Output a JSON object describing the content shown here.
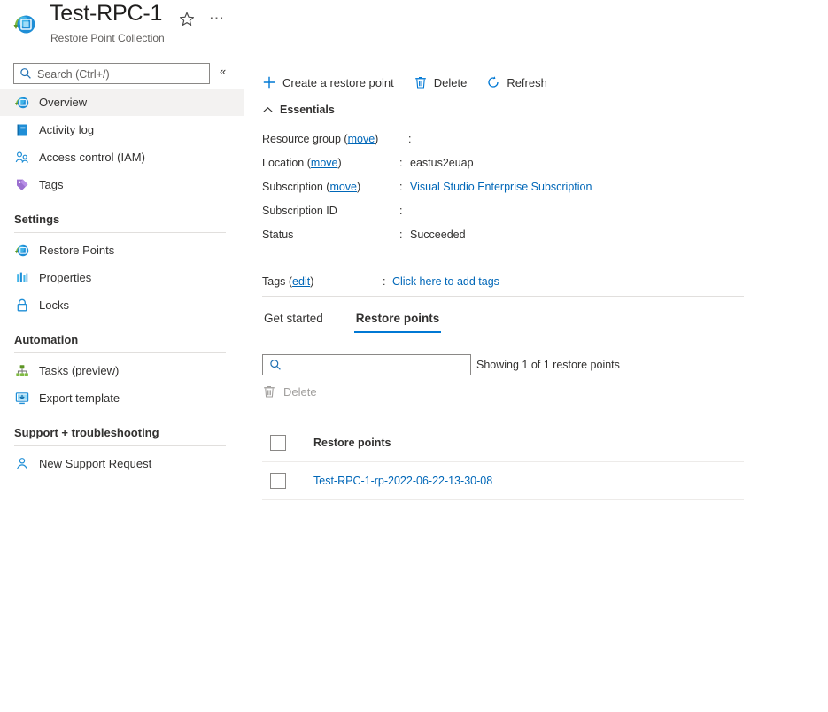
{
  "header": {
    "title": "Test-RPC-1",
    "subtitle": "Restore Point Collection",
    "favorite_icon": "star-icon",
    "more_icon": "ellipsis-icon",
    "resource_icon": "restore-point-collection-icon"
  },
  "sidebar": {
    "search": {
      "value": "",
      "placeholder": "Search (Ctrl+/)",
      "icon": "search-icon"
    },
    "collapse": {
      "label": "«",
      "icon": "chevron-double-left-icon"
    },
    "items": [
      {
        "label": "Overview",
        "icon": "overview-icon",
        "selected": true
      },
      {
        "label": "Activity log",
        "icon": "activity-log-icon",
        "selected": false
      },
      {
        "label": "Access control (IAM)",
        "icon": "access-control-icon",
        "selected": false
      },
      {
        "label": "Tags",
        "icon": "tags-icon",
        "selected": false
      }
    ],
    "sections": [
      {
        "heading": "Settings",
        "items": [
          {
            "label": "Restore Points",
            "icon": "restore-points-icon"
          },
          {
            "label": "Properties",
            "icon": "properties-icon"
          },
          {
            "label": "Locks",
            "icon": "lock-icon"
          }
        ]
      },
      {
        "heading": "Automation",
        "items": [
          {
            "label": "Tasks (preview)",
            "icon": "tasks-icon"
          },
          {
            "label": "Export template",
            "icon": "export-template-icon"
          }
        ]
      },
      {
        "heading": "Support + troubleshooting",
        "items": [
          {
            "label": "New Support Request",
            "icon": "support-request-icon"
          }
        ]
      }
    ]
  },
  "toolbar": {
    "create": {
      "label": "Create a restore point",
      "icon": "plus-icon"
    },
    "delete": {
      "label": "Delete",
      "icon": "trash-icon"
    },
    "refresh": {
      "label": "Refresh",
      "icon": "refresh-icon"
    }
  },
  "essentials": {
    "heading": "Essentials",
    "collapse_icon": "chevron-up-icon",
    "rows": [
      {
        "label": "Resource group",
        "link": "move",
        "colon": ":",
        "value": "",
        "value_is_link": false,
        "wide": true
      },
      {
        "label": "Location",
        "link": "move",
        "colon": ":",
        "value": "eastus2euap",
        "value_is_link": false,
        "wide": false
      },
      {
        "label": "Subscription",
        "link": "move",
        "colon": ":",
        "value": "Visual Studio Enterprise Subscription",
        "value_is_link": true,
        "wide": false
      },
      {
        "label": "Subscription ID",
        "link": "",
        "colon": ":",
        "value": "",
        "value_is_link": false,
        "wide": false
      },
      {
        "label": "Status",
        "link": "",
        "colon": ":",
        "value": "Succeeded",
        "value_is_link": false,
        "wide": false
      }
    ],
    "tags": {
      "label": "Tags",
      "link": "edit",
      "colon": ":",
      "value": "Click here to add tags"
    }
  },
  "tabs": [
    {
      "label": "Get started",
      "active": false
    },
    {
      "label": "Restore points",
      "active": true
    }
  ],
  "restore_points_panel": {
    "filter": {
      "value": "",
      "placeholder": "",
      "icon": "search-icon"
    },
    "showing_text": "Showing 1 of 1 restore points",
    "grid_delete": {
      "label": "Delete",
      "icon": "trash-icon",
      "disabled": true
    },
    "columns": [
      "Restore points"
    ],
    "rows": [
      {
        "name": "Test-RPC-1-rp-2022-06-22-13-30-08",
        "checked": false
      }
    ]
  },
  "colors": {
    "accent": "#0078d4",
    "link": "#0067b8",
    "selected_nav_bg": "#f3f2f1",
    "divider": "#e1dfdd",
    "disabled_text": "#a19f9d"
  }
}
